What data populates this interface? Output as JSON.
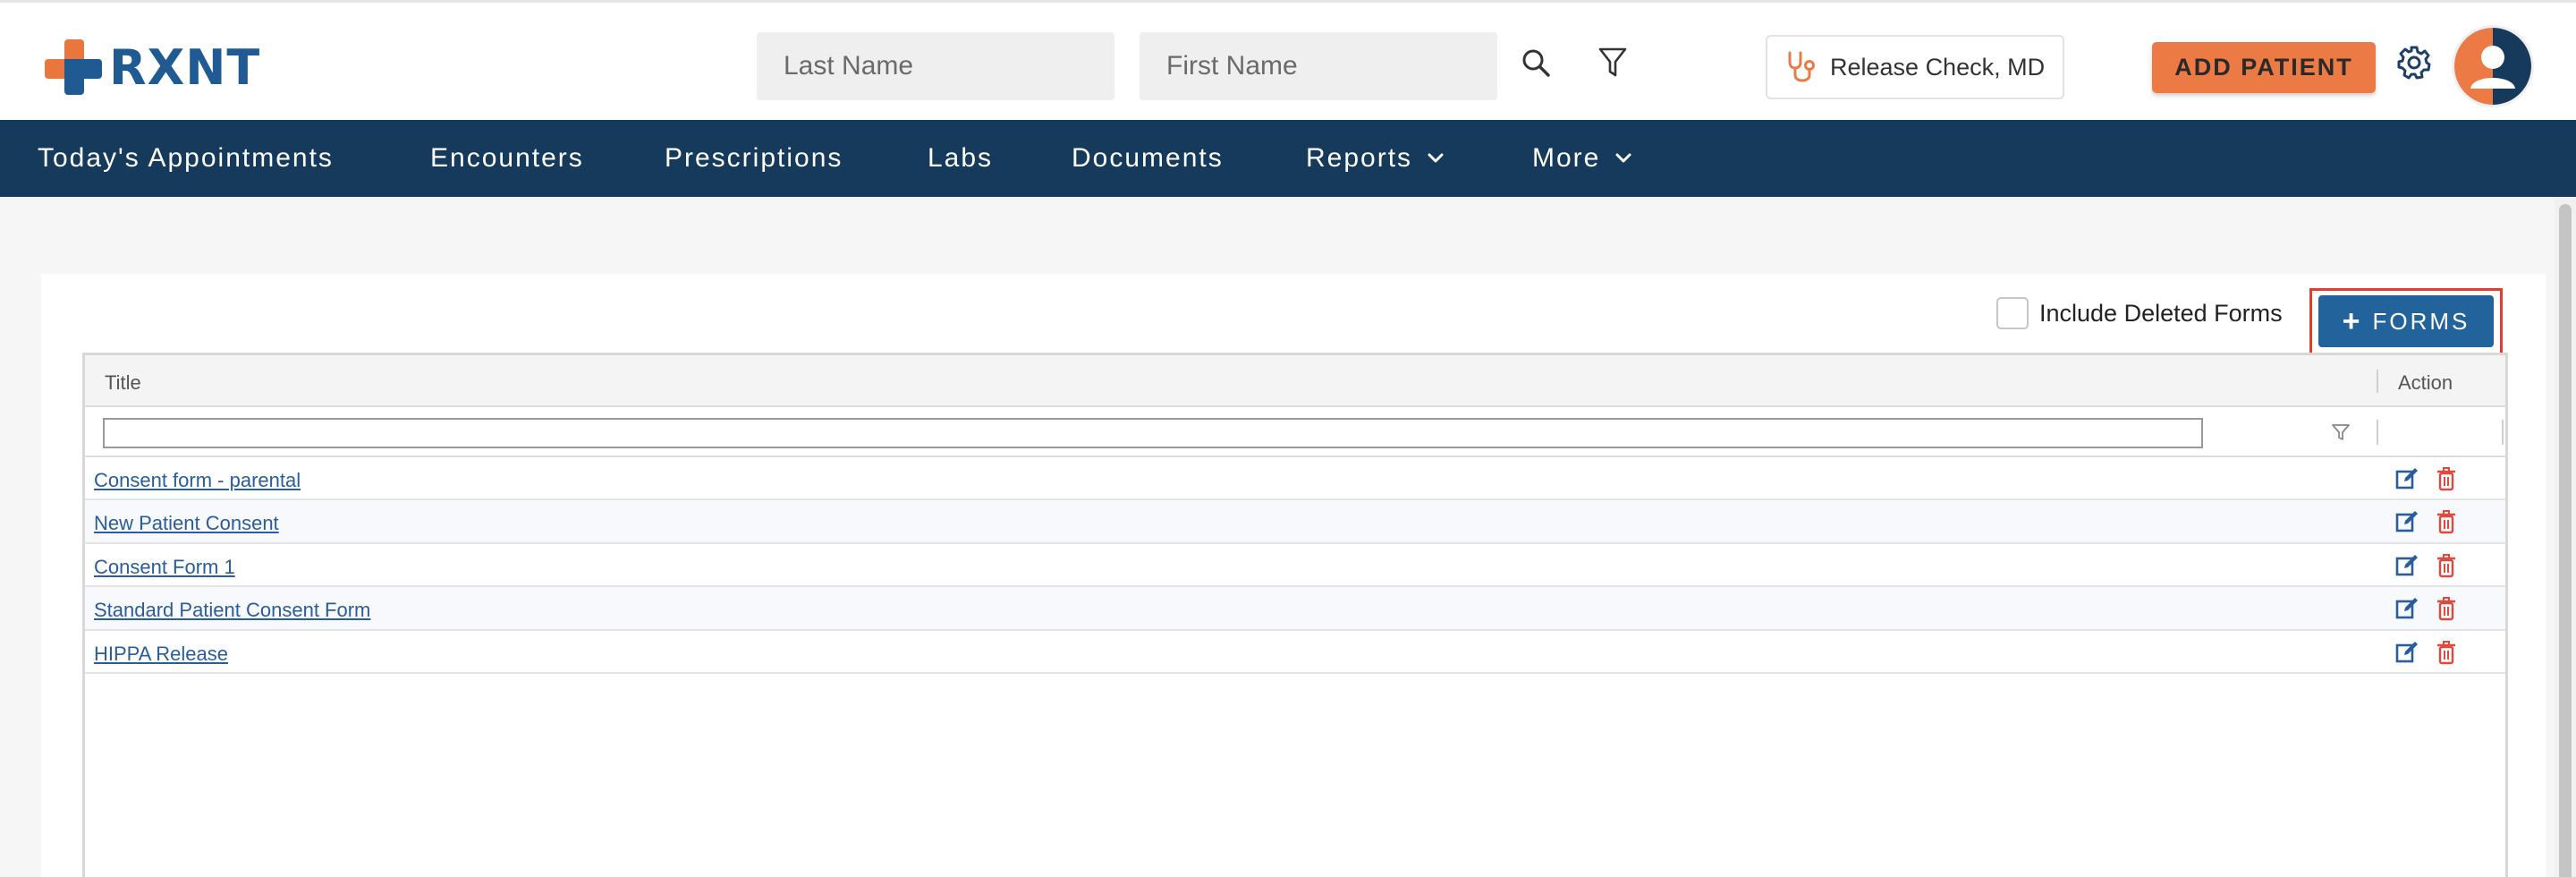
{
  "app": {
    "logo_text": "RXNT"
  },
  "header": {
    "last_name_placeholder": "Last Name",
    "first_name_placeholder": "First Name",
    "provider_label": "Release Check, MD",
    "add_patient_label": "ADD PATIENT",
    "icons": [
      "search-icon",
      "filter-icon",
      "stethoscope-icon",
      "gear-icon",
      "avatar"
    ]
  },
  "nav": {
    "items": [
      {
        "label": "Today's Appointments"
      },
      {
        "label": "Encounters"
      },
      {
        "label": "Prescriptions"
      },
      {
        "label": "Labs"
      },
      {
        "label": "Documents"
      },
      {
        "label": "Reports",
        "has_dropdown": true
      },
      {
        "label": "More",
        "has_dropdown": true
      }
    ]
  },
  "forms": {
    "include_deleted_label": "Include Deleted Forms",
    "include_deleted_checked": false,
    "add_button_label": "FORMS",
    "add_button_highlighted": true
  },
  "grid": {
    "columns": [
      "Title",
      "Action"
    ],
    "filter_value": "",
    "rows": [
      {
        "title": "Consent form - parental"
      },
      {
        "title": "New Patient Consent"
      },
      {
        "title": "Consent Form 1"
      },
      {
        "title": "Standard Patient Consent Form"
      },
      {
        "title": "HIPPA Release"
      }
    ]
  },
  "colors": {
    "nav_bg": "#163a5c",
    "brand_blue": "#1f5a92",
    "brand_orange": "#ec7a45",
    "button_blue": "#23639c",
    "highlight_red": "#e23e2f",
    "delete_red": "#e04a3d"
  }
}
